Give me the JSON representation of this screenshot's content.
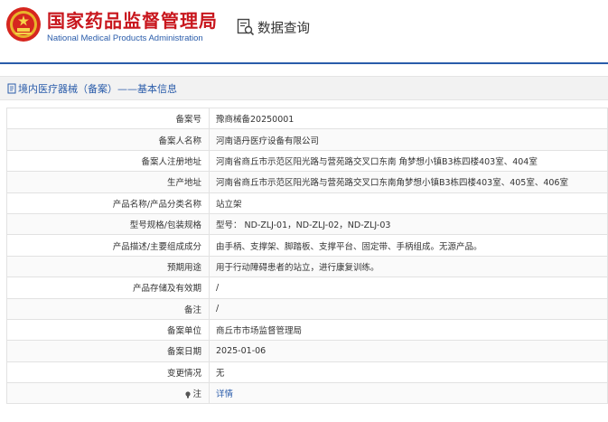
{
  "header": {
    "title": "国家药品监督管理局",
    "subtitle": "National Medical Products Administration",
    "query_label": "数据查询"
  },
  "breadcrumb": {
    "text": "境内医疗器械（备案）——基本信息"
  },
  "rows": [
    {
      "label": "备案号",
      "value": "豫商械备20250001"
    },
    {
      "label": "备案人名称",
      "value": "河南语丹医疗设备有限公司"
    },
    {
      "label": "备案人注册地址",
      "value": "河南省商丘市示范区阳光路与营苑路交叉口东南 角梦想小镇B3栋四楼403室、404室"
    },
    {
      "label": "生产地址",
      "value": "河南省商丘市示范区阳光路与营苑路交叉口东南角梦想小镇B3栋四楼403室、405室、406室"
    },
    {
      "label": "产品名称/产品分类名称",
      "value": "站立架"
    },
    {
      "label": "型号规格/包装规格",
      "value": "型号： ND-ZLJ-01，ND-ZLJ-02，ND-ZLJ-03"
    },
    {
      "label": "产品描述/主要组成成分",
      "value": "由手柄、支撑架、脚踏板、支撑平台、固定带、手柄组成。无源产品。"
    },
    {
      "label": "预期用途",
      "value": "用于行动障碍患者的站立，进行康复训练。"
    },
    {
      "label": "产品存储及有效期",
      "value": "/"
    },
    {
      "label": "备注",
      "value": "/"
    },
    {
      "label": "备案单位",
      "value": "商丘市市场监督管理局"
    },
    {
      "label": "备案日期",
      "value": "2025-01-06"
    },
    {
      "label": "变更情况",
      "value": "无"
    },
    {
      "label": "注",
      "value": "详情"
    }
  ],
  "colors": {
    "brand_red": "#c8161d",
    "brand_blue": "#2a5caa"
  },
  "icons": {
    "emblem": "national-emblem-icon",
    "query": "data-query-icon",
    "breadcrumb": "document-icon",
    "note": "lightbulb-icon"
  }
}
